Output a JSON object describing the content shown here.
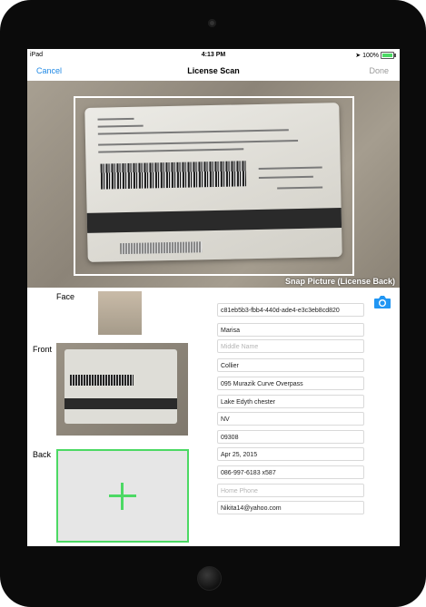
{
  "status_bar": {
    "device": "iPad",
    "time": "4:13 PM",
    "battery": "100%"
  },
  "nav": {
    "cancel_label": "Cancel",
    "title": "License Scan",
    "done_label": "Done"
  },
  "camera": {
    "snap_label": "Snap Picture (License Back)"
  },
  "labels": {
    "face": "Face",
    "front": "Front",
    "back": "Back"
  },
  "fields": [
    {
      "name": "id-field",
      "value": "c81eb5b3-fbb4-440d-ade4-e3c3eb8cd820",
      "placeholder": ""
    },
    {
      "name": "first-name-field",
      "value": "Marisa",
      "placeholder": ""
    },
    {
      "name": "middle-name-field",
      "value": "",
      "placeholder": "Middle Name"
    },
    {
      "name": "last-name-field",
      "value": "Collier",
      "placeholder": ""
    },
    {
      "name": "street-field",
      "value": "095 Murazik Curve Overpass",
      "placeholder": ""
    },
    {
      "name": "city-field",
      "value": "Lake Edyth chester",
      "placeholder": ""
    },
    {
      "name": "state-field",
      "value": "NV",
      "placeholder": ""
    },
    {
      "name": "zip-field",
      "value": "09308",
      "placeholder": ""
    },
    {
      "name": "date-field",
      "value": "Apr 25, 2015",
      "placeholder": ""
    },
    {
      "name": "phone-field",
      "value": "086-997-6183 x587",
      "placeholder": ""
    },
    {
      "name": "home-phone-field",
      "value": "",
      "placeholder": "Home Phone"
    },
    {
      "name": "email-field",
      "value": "Nikita14@yahoo.com",
      "placeholder": ""
    }
  ],
  "colors": {
    "accent": "#1e88e5",
    "green": "#4cd964",
    "camera_icon": "#2196f3"
  },
  "icons": {
    "camera_button": "camera-icon",
    "add_back": "plus-icon"
  }
}
